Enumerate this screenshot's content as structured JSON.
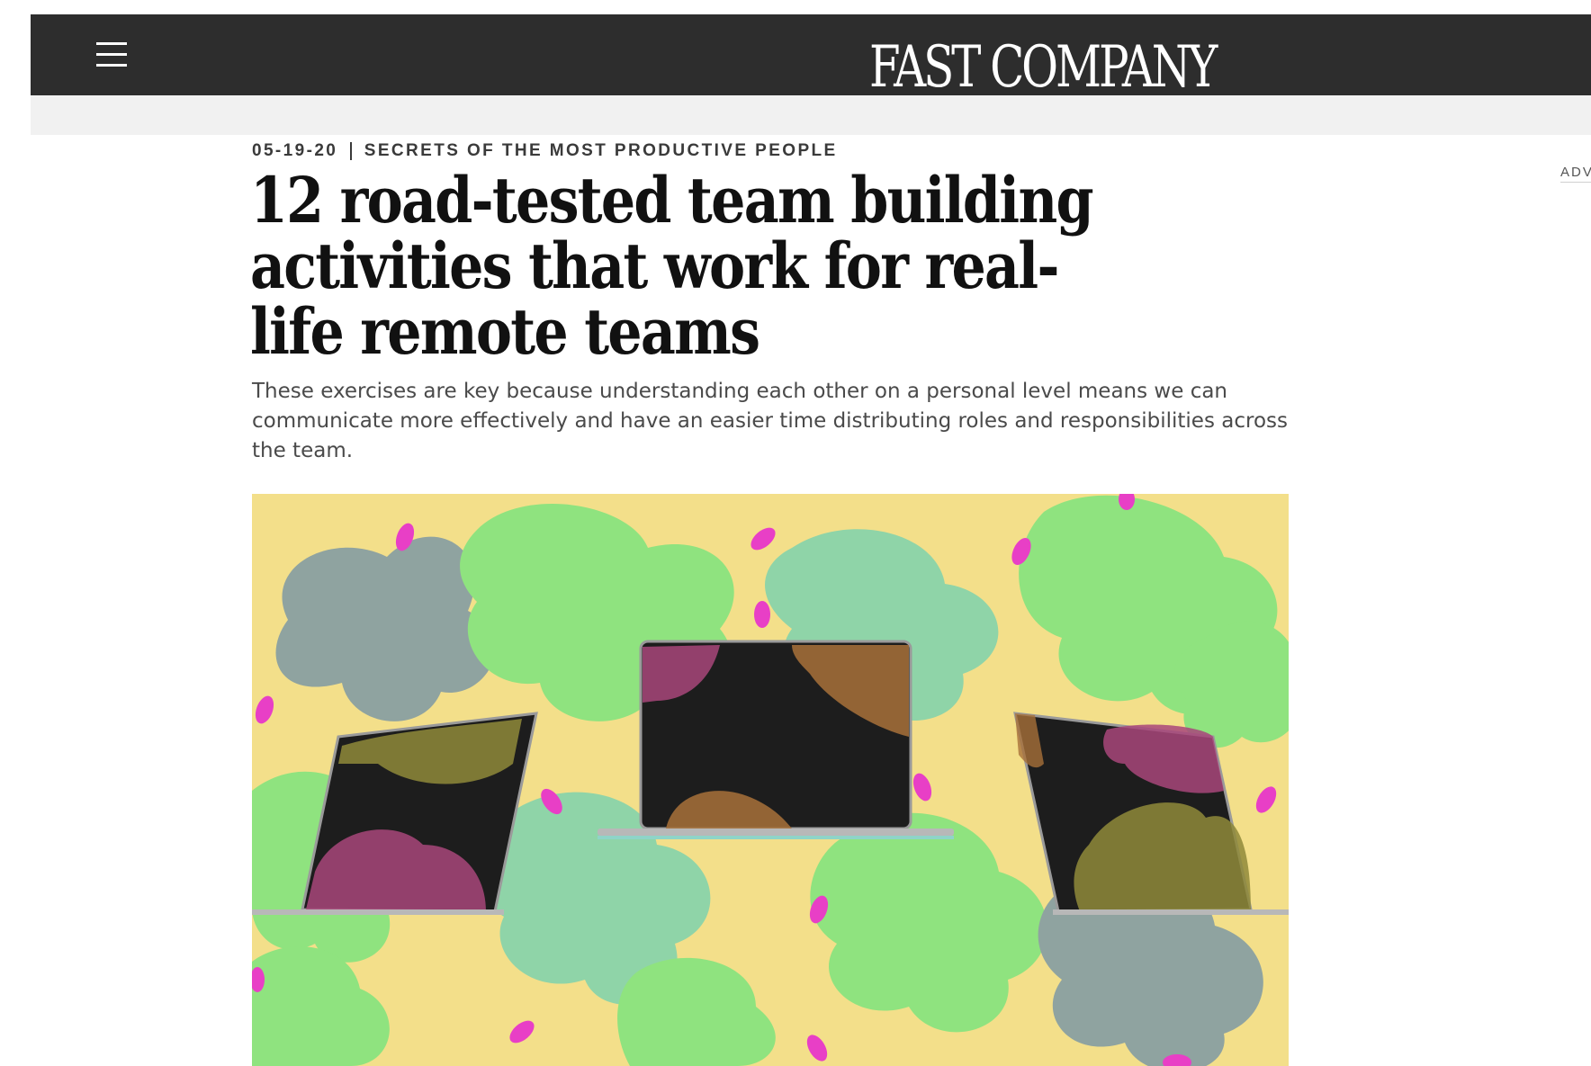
{
  "header": {
    "logo_text": "FAST COMPANY",
    "menu_icon": "hamburger-menu-icon",
    "background_color": "#2d2d2d"
  },
  "article": {
    "date": "05-19-20",
    "category": "SECRETS OF THE MOST PRODUCTIVE PEOPLE",
    "headline": "12 road-tested team building activities that work for real-life remote teams",
    "deck": "These exercises are key because understanding each other on a personal level means we can communicate more effectively and have an easier time distributing roles and responsibilities across the team.",
    "hero_image_description_colors": {
      "background": "#f3df8a",
      "green": "#8fe37f",
      "teal": "#8fd4a8",
      "gray": "#8fa3a0",
      "pink": "#e83fc6"
    }
  },
  "sidebar": {
    "ad_label": "ADV"
  }
}
